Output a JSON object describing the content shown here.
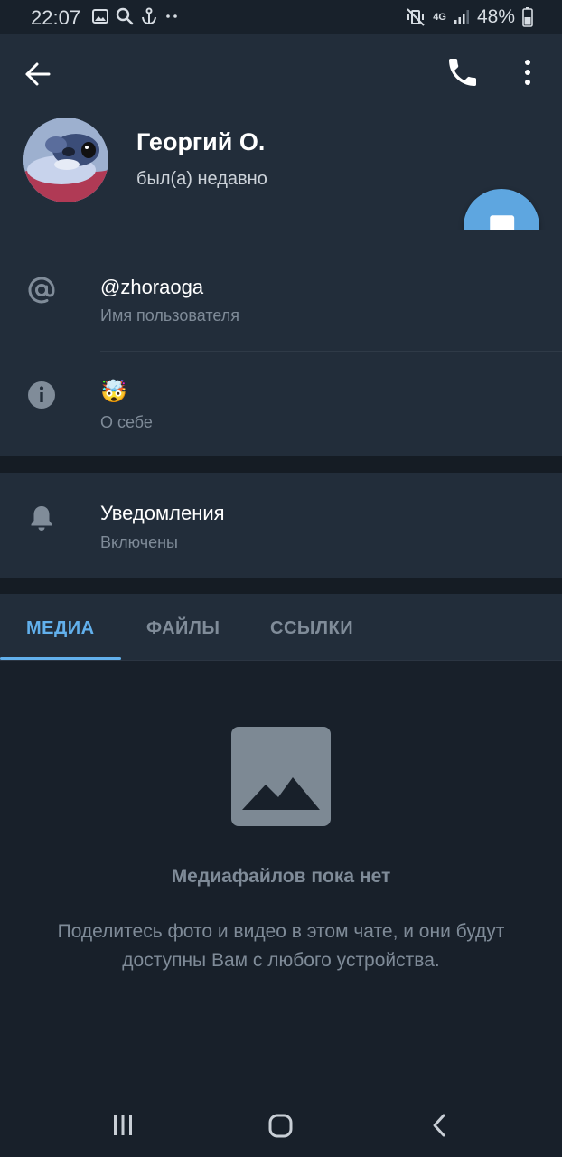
{
  "status_bar": {
    "time": "22:07",
    "network": "4G",
    "battery": "48%"
  },
  "header": {
    "name": "Георгий О.",
    "status": "был(а) недавно"
  },
  "info": {
    "username": "@zhoraoga",
    "username_label": "Имя пользователя",
    "bio": "🤯",
    "bio_label": "О себе"
  },
  "notifications": {
    "title": "Уведомления",
    "state": "Включены"
  },
  "tabs": [
    {
      "label": "МЕДИА",
      "active": true
    },
    {
      "label": "ФАЙЛЫ",
      "active": false
    },
    {
      "label": "ССЫЛКИ",
      "active": false
    }
  ],
  "empty_state": {
    "title": "Медиафайлов пока нет",
    "text": "Поделитесь фото и видео в этом чате, и они будут доступны Вам с любого устройства."
  },
  "colors": {
    "accent": "#62b0ec",
    "fab": "#5ea6e0",
    "header_bg": "#222d3a",
    "page_bg": "#18202a"
  },
  "icons": {
    "back": "arrow-left-icon",
    "call": "phone-icon",
    "more": "more-vertical-icon",
    "fab": "message-icon",
    "username": "at-sign-icon",
    "bio": "info-icon",
    "notifications": "bell-icon",
    "empty": "image-placeholder-icon"
  }
}
